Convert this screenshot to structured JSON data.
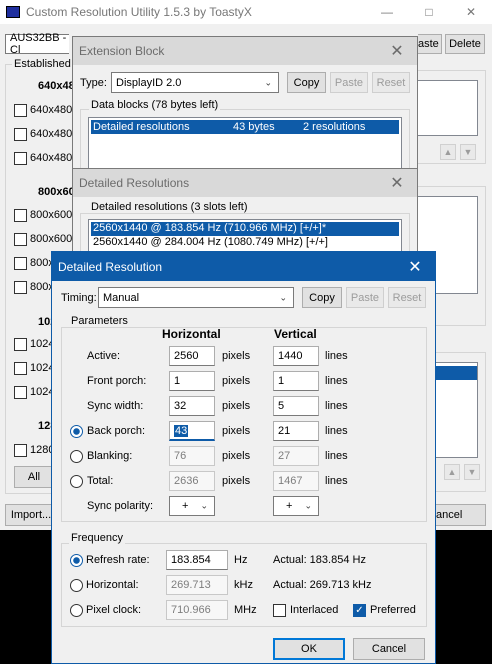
{
  "main": {
    "title": "Custom Resolution Utility 1.5.3 by ToastyX",
    "monitor_value": "AUS32BB - Cl",
    "paste_label": "aste",
    "delete_label": "Delete",
    "established_label": "Established",
    "sections": [
      "640x48",
      "800x60",
      "102",
      "128"
    ],
    "items_640": [
      "640x480",
      "640x480",
      "640x480"
    ],
    "items_800": [
      "800x600",
      "800x600",
      "800x",
      "800x"
    ],
    "items_1024": [
      "1024",
      "1024",
      "1024"
    ],
    "items_1280": [
      "1280"
    ],
    "all_label": "All",
    "import_label": "Import...",
    "cancel_label": "ancel"
  },
  "ext": {
    "title": "Extension Block",
    "type_label": "Type:",
    "type_value": "DisplayID 2.0",
    "copy_label": "Copy",
    "paste_label": "Paste",
    "reset_label": "Reset",
    "data_blocks_label": "Data blocks (78 bytes left)",
    "row": {
      "name": "Detailed resolutions",
      "size": "43 bytes",
      "count": "2 resolutions"
    }
  },
  "detres": {
    "title": "Detailed Resolutions",
    "group_label": "Detailed resolutions (3 slots left)",
    "rows": [
      "2560x1440 @ 183.854 Hz (710.966 MHz) [+/+]*",
      "2560x1440 @ 284.004 Hz (1080.749 MHz) [+/+]"
    ]
  },
  "dlg": {
    "title": "Detailed Resolution",
    "timing_label": "Timing:",
    "timing_value": "Manual",
    "copy_label": "Copy",
    "paste_label": "Paste",
    "reset_label": "Reset",
    "params_label": "Parameters",
    "horizontal_header": "Horizontal",
    "vertical_header": "Vertical",
    "rows": [
      {
        "label": "Active:",
        "h": "2560",
        "hu": "pixels",
        "v": "1440",
        "vu": "lines"
      },
      {
        "label": "Front porch:",
        "h": "1",
        "hu": "pixels",
        "v": "1",
        "vu": "lines"
      },
      {
        "label": "Sync width:",
        "h": "32",
        "hu": "pixels",
        "v": "5",
        "vu": "lines"
      },
      {
        "label": "Back porch:",
        "h": "43",
        "hu": "pixels",
        "v": "21",
        "vu": "lines"
      },
      {
        "label": "Blanking:",
        "h": "76",
        "hu": "pixels",
        "v": "27",
        "vu": "lines"
      },
      {
        "label": "Total:",
        "h": "2636",
        "hu": "pixels",
        "v": "1467",
        "vu": "lines"
      }
    ],
    "sync_polarity_label": "Sync polarity:",
    "sync_h": "+",
    "sync_v": "+",
    "frequency_label": "Frequency",
    "refresh_label": "Refresh rate:",
    "refresh_value": "183.854",
    "refresh_unit": "Hz",
    "refresh_actual": "Actual: 183.854 Hz",
    "horizontal_label": "Horizontal:",
    "horizontal_value": "269.713",
    "horizontal_unit": "kHz",
    "horizontal_actual": "Actual: 269.713 kHz",
    "pixel_clock_label": "Pixel clock:",
    "pixel_clock_value": "710.966",
    "pixel_clock_unit": "MHz",
    "interlaced_label": "Interlaced",
    "preferred_label": "Preferred",
    "ok_label": "OK",
    "cancel_label": "Cancel"
  },
  "colors": {
    "accent": "#0e5ba8",
    "window_bg": "#f0f0f0"
  }
}
